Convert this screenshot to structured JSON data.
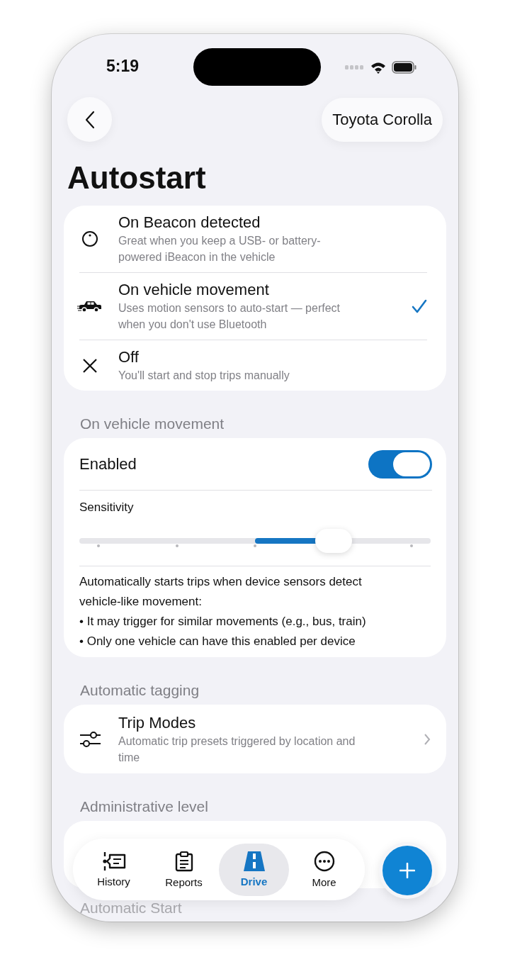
{
  "status_bar": {
    "time": "5:19"
  },
  "header": {
    "vehicle": "Toyota Corolla",
    "title": "Autostart"
  },
  "modes": [
    {
      "kind": "beacon",
      "title": "On Beacon detected",
      "subtitle": "Great when you keep a USB- or battery-powered iBeacon in the vehicle",
      "selected": false
    },
    {
      "kind": "movement",
      "title": "On vehicle movement",
      "subtitle": "Uses motion sensors to auto-start — perfect when you don't use Bluetooth",
      "selected": true
    },
    {
      "kind": "off",
      "title": "Off",
      "subtitle": "You'll start and stop trips manually",
      "selected": false
    }
  ],
  "movement": {
    "header": "On vehicle movement",
    "enabled_label": "Enabled",
    "enabled": true,
    "sensitivity_label": "Sensitivity",
    "level": 0.75,
    "description": "Automatically starts trips when device sensors detect vehicle-like movement:",
    "bullets": [
      "• It may trigger for similar movements (e.g., bus, train)",
      "• Only one vehicle can have this enabled per device"
    ]
  },
  "tagging": {
    "header": "Automatic tagging",
    "items": [
      {
        "title": "Trip Modes",
        "subtitle": "Automatic trip presets triggered by location and time"
      }
    ]
  },
  "admin": {
    "header": "Administrative level"
  },
  "next_header": "Automatic Start",
  "nav": [
    {
      "kind": "history",
      "label": "History",
      "selected": false
    },
    {
      "kind": "reports",
      "label": "Reports",
      "selected": false
    },
    {
      "kind": "drive",
      "label": "Drive",
      "selected": true
    },
    {
      "kind": "more",
      "label": "More",
      "selected": false
    }
  ]
}
